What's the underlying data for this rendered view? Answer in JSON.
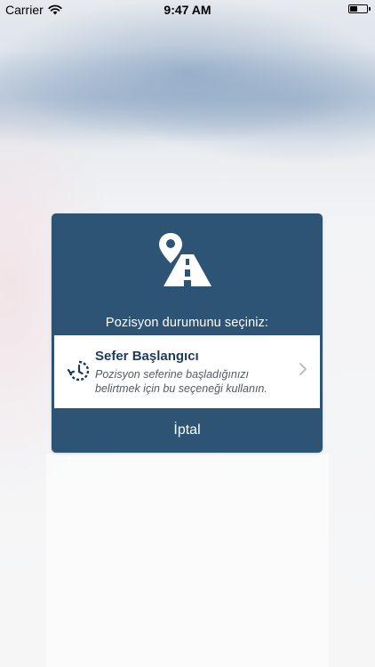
{
  "status_bar": {
    "carrier": "Carrier",
    "time": "9:47 AM",
    "wifi_icon": "wifi-icon",
    "battery_icon": "battery-icon"
  },
  "dialog": {
    "header_icon": "map-pin-road-icon",
    "title": "Pozisyon durumunu seçiniz:",
    "options": [
      {
        "icon": "voyage-start-icon",
        "title": "Sefer Başlangıcı",
        "description": "Pozisyon seferine başladığınızı belirtmek için bu seçeneği kullanın.",
        "chevron_icon": "chevron-right-icon"
      }
    ],
    "cancel_label": "İptal"
  },
  "colors": {
    "dialog_background": "#2d5474",
    "option_title": "#1d3a5c",
    "option_description": "#555a60"
  }
}
